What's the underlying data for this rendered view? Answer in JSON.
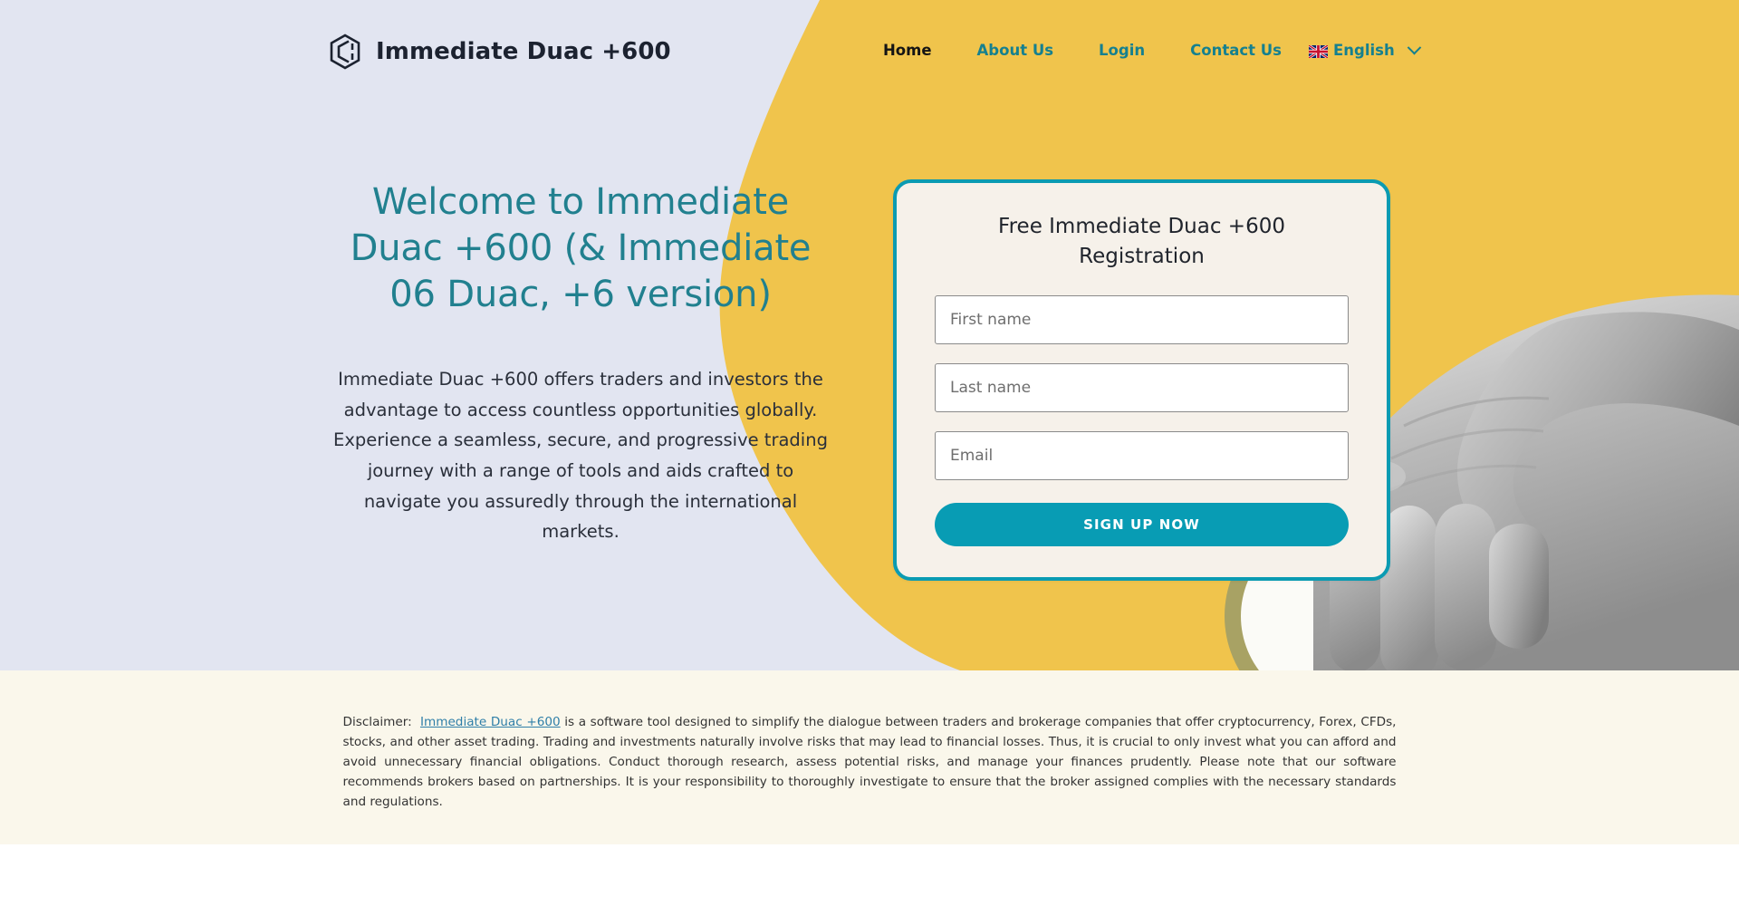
{
  "brand": {
    "name": "Immediate Duac +600",
    "logo_icon": "hexagon-c-logo-icon"
  },
  "nav": {
    "items": [
      {
        "label": "Home",
        "active": true
      },
      {
        "label": "About Us",
        "active": false
      },
      {
        "label": "Login",
        "active": false
      },
      {
        "label": "Contact Us",
        "active": false
      }
    ],
    "language": {
      "label": "English",
      "flag_icon": "uk-flag-icon",
      "chevron_icon": "chevron-down-icon"
    }
  },
  "hero": {
    "title": "Welcome to Immediate Duac +600 (& Immediate 06 Duac, +6 version)",
    "subtitle": "Immediate Duac +600 offers traders and investors the advantage to access countless opportunities globally. Experience a seamless, secure, and progressive trading journey with a range of tools and aids crafted to navigate you assuredly through the international markets.",
    "image_alt": "grayscale-hand-reaching-for-coin"
  },
  "form": {
    "title": "Free Immediate Duac +600 Registration",
    "first_name": {
      "placeholder": "First name",
      "value": ""
    },
    "last_name": {
      "placeholder": "Last name",
      "value": ""
    },
    "email": {
      "placeholder": "Email",
      "value": ""
    },
    "submit_label": "SIGN UP NOW"
  },
  "disclaimer": {
    "prefix": "Disclaimer:",
    "link_text": "Immediate Duac +600",
    "body": " is a software tool designed to simplify the dialogue between traders and brokerage companies that offer cryptocurrency, Forex, CFDs, stocks, and other asset trading. Trading and investments naturally involve risks that may lead to financial losses. Thus, it is crucial to only invest what you can afford and avoid unnecessary financial obligations. Conduct thorough research, assess potential risks, and manage your finances prudently. Please note that our software recommends brokers based on partnerships. It is your responsibility to thoroughly investigate to ensure that the broker assigned complies with the necessary standards and regulations."
  },
  "colors": {
    "lavender": "#E2E5F1",
    "yellow": "#F0C44C",
    "teal": "#089CB4",
    "teal_text": "#15808F",
    "heading_teal": "#21808F",
    "card_bg": "#F6F1EA",
    "cream_band": "#FAF7EB",
    "coin_gold": "#A8A264",
    "dark_text": "#1C2230"
  }
}
